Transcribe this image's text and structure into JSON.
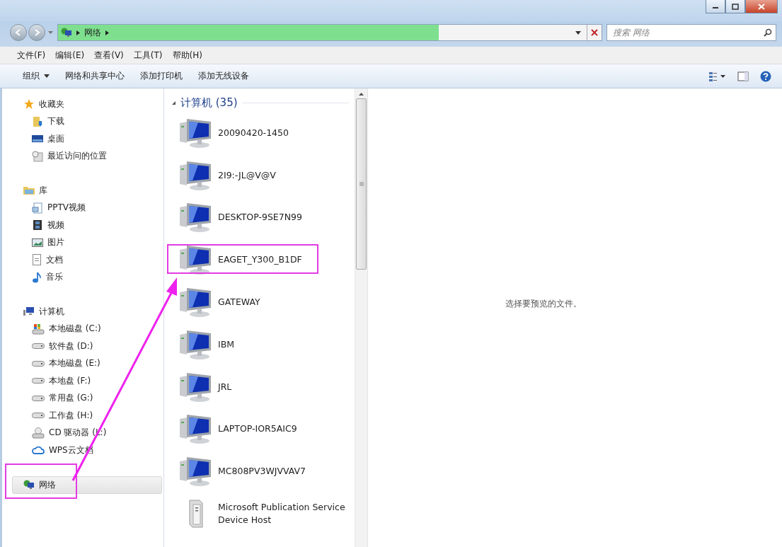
{
  "address": {
    "crumbs": [
      "网络"
    ],
    "level": 0.7
  },
  "search": {
    "placeholder": "搜索 网络"
  },
  "menu": [
    "文件(F)",
    "编辑(E)",
    "查看(V)",
    "工具(T)",
    "帮助(H)"
  ],
  "toolbar": [
    {
      "label": "组织",
      "dropdown": true
    },
    {
      "label": "网络和共享中心",
      "dropdown": false
    },
    {
      "label": "添加打印机",
      "dropdown": false
    },
    {
      "label": "添加无线设备",
      "dropdown": false
    }
  ],
  "nav": [
    {
      "label": "收藏夹",
      "kind": "favorites",
      "selected": false,
      "highlighted": false,
      "children": [
        {
          "label": "下载",
          "kind": "download"
        },
        {
          "label": "桌面",
          "kind": "desktop"
        },
        {
          "label": "最近访问的位置",
          "kind": "recent"
        }
      ]
    },
    {
      "label": "库",
      "kind": "library",
      "selected": false,
      "highlighted": false,
      "children": [
        {
          "label": "PPTV视频",
          "kind": "pptv"
        },
        {
          "label": "视频",
          "kind": "video"
        },
        {
          "label": "图片",
          "kind": "picture"
        },
        {
          "label": "文档",
          "kind": "document"
        },
        {
          "label": "音乐",
          "kind": "music"
        }
      ]
    },
    {
      "label": "计算机",
      "kind": "computer",
      "selected": false,
      "highlighted": false,
      "children": [
        {
          "label": "本地磁盘 (C:)",
          "kind": "system"
        },
        {
          "label": "软件盘 (D:)",
          "kind": "disk"
        },
        {
          "label": "本地磁盘 (E:)",
          "kind": "disk"
        },
        {
          "label": "本地盘 (F:)",
          "kind": "disk"
        },
        {
          "label": "常用盘 (G:)",
          "kind": "disk"
        },
        {
          "label": "工作盘 (H:)",
          "kind": "disk"
        },
        {
          "label": "CD 驱动器 (L:)",
          "kind": "cd"
        },
        {
          "label": "WPS云文档",
          "kind": "cloud"
        }
      ]
    },
    {
      "label": "网络",
      "kind": "network",
      "selected": true,
      "highlighted": true
    }
  ],
  "group": {
    "title": "计算机 (35)",
    "expanded": true
  },
  "items": [
    {
      "name": "20090420-1450",
      "kind": "computer",
      "highlighted": false
    },
    {
      "name": "2I9:-JL@V@V",
      "kind": "computer",
      "highlighted": false
    },
    {
      "name": "DESKTOP-9SE7N99",
      "kind": "computer",
      "highlighted": false
    },
    {
      "name": "EAGET_Y300_B1DF",
      "kind": "computer",
      "highlighted": true
    },
    {
      "name": "GATEWAY",
      "kind": "computer",
      "highlighted": false
    },
    {
      "name": "IBM",
      "kind": "computer",
      "highlighted": false
    },
    {
      "name": "JRL",
      "kind": "computer",
      "highlighted": false
    },
    {
      "name": "LAPTOP-IOR5AIC9",
      "kind": "computer",
      "highlighted": false
    },
    {
      "name": "MC808PV3WJVVAV7",
      "kind": "computer",
      "highlighted": false
    },
    {
      "name": "Microsoft Publication Service Device Host",
      "kind": "device",
      "highlighted": false
    }
  ],
  "preview": {
    "message": "选择要预览的文件。"
  }
}
